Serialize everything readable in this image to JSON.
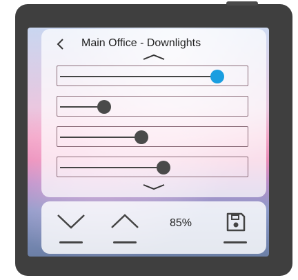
{
  "header": {
    "title": "Main Office - Downlights"
  },
  "sliders": [
    {
      "name": "slider-1",
      "value": 0.85,
      "active": true
    },
    {
      "name": "slider-2",
      "value": 0.24,
      "active": false
    },
    {
      "name": "slider-3",
      "value": 0.44,
      "active": false
    },
    {
      "name": "slider-4",
      "value": 0.56,
      "active": false
    }
  ],
  "footer": {
    "level_label": "85%"
  },
  "colors": {
    "accent": "#1a9ee0",
    "knob": "#4a4a4a"
  },
  "icons": [
    "back-chevron-icon",
    "scroll-up-icon",
    "scroll-down-icon",
    "level-down-icon",
    "level-up-icon",
    "save-icon"
  ]
}
